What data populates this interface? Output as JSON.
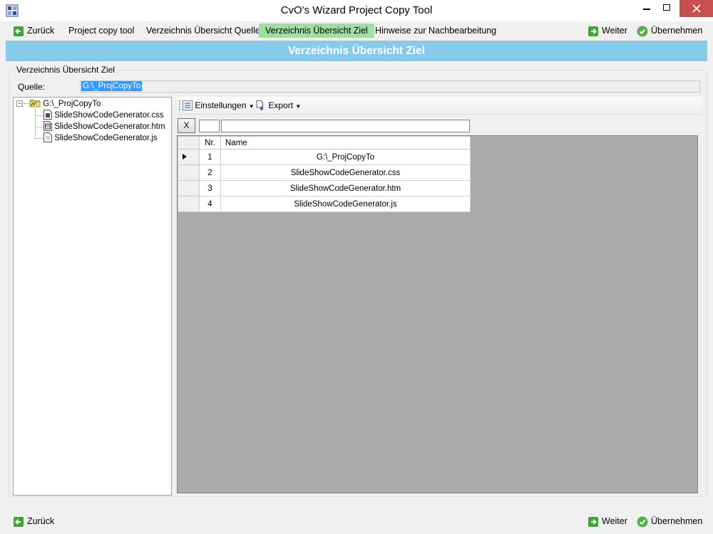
{
  "window": {
    "title": "CvO's Wizard Project Copy Tool"
  },
  "nav": {
    "back": "Zurück",
    "steps": [
      "Project copy tool",
      "Verzeichnis Übersicht Quelle",
      "Verzeichnis Übersicht Ziel",
      "Hinweise zur Nachbearbeitung"
    ],
    "active_step": 2,
    "next": "Weiter",
    "apply": "Übernehmen"
  },
  "header": {
    "title": "Verzeichnis Übersicht Ziel"
  },
  "group": {
    "legend": "Verzeichnis Übersicht Ziel",
    "source_label": "Quelle:",
    "source_value": "G:\\_ProjCopyTo"
  },
  "tree": {
    "root": "G:\\_ProjCopyTo",
    "children": [
      "SlideShowCodeGenerator.css",
      "SlideShowCodeGenerator.htm",
      "SlideShowCodeGenerator.js"
    ]
  },
  "toolbar": {
    "settings": "Einstellungen",
    "export": "Export"
  },
  "filter": {
    "clear_label": "X"
  },
  "grid": {
    "columns": [
      "Nr.",
      "Name"
    ],
    "rows": [
      {
        "nr": "1",
        "name": "G:\\_ProjCopyTo"
      },
      {
        "nr": "2",
        "name": "SlideShowCodeGenerator.css"
      },
      {
        "nr": "3",
        "name": "SlideShowCodeGenerator.htm"
      },
      {
        "nr": "4",
        "name": "SlideShowCodeGenerator.js"
      }
    ],
    "current_row": 0
  },
  "colors": {
    "header_band": "#86cbe9",
    "active_step": "#9de0a0",
    "close_button": "#c74f4f",
    "selection": "#3399ff",
    "grid_background": "#ababab"
  },
  "icons": {
    "back": "green-left-arrow-icon",
    "next": "green-right-arrow-icon",
    "apply": "green-check-icon",
    "app": "wizard-app-icon"
  }
}
